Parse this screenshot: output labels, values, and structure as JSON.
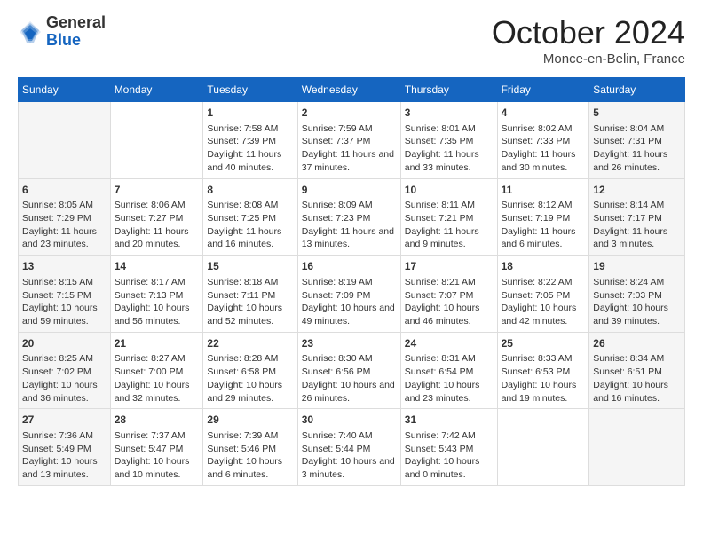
{
  "header": {
    "logo": {
      "general": "General",
      "blue": "Blue"
    },
    "title": "October 2024",
    "location": "Monce-en-Belin, France"
  },
  "days_of_week": [
    "Sunday",
    "Monday",
    "Tuesday",
    "Wednesday",
    "Thursday",
    "Friday",
    "Saturday"
  ],
  "weeks": [
    [
      {
        "day": "",
        "sunrise": "",
        "sunset": "",
        "daylight": ""
      },
      {
        "day": "",
        "sunrise": "",
        "sunset": "",
        "daylight": ""
      },
      {
        "day": "1",
        "sunrise": "Sunrise: 7:58 AM",
        "sunset": "Sunset: 7:39 PM",
        "daylight": "Daylight: 11 hours and 40 minutes."
      },
      {
        "day": "2",
        "sunrise": "Sunrise: 7:59 AM",
        "sunset": "Sunset: 7:37 PM",
        "daylight": "Daylight: 11 hours and 37 minutes."
      },
      {
        "day": "3",
        "sunrise": "Sunrise: 8:01 AM",
        "sunset": "Sunset: 7:35 PM",
        "daylight": "Daylight: 11 hours and 33 minutes."
      },
      {
        "day": "4",
        "sunrise": "Sunrise: 8:02 AM",
        "sunset": "Sunset: 7:33 PM",
        "daylight": "Daylight: 11 hours and 30 minutes."
      },
      {
        "day": "5",
        "sunrise": "Sunrise: 8:04 AM",
        "sunset": "Sunset: 7:31 PM",
        "daylight": "Daylight: 11 hours and 26 minutes."
      }
    ],
    [
      {
        "day": "6",
        "sunrise": "Sunrise: 8:05 AM",
        "sunset": "Sunset: 7:29 PM",
        "daylight": "Daylight: 11 hours and 23 minutes."
      },
      {
        "day": "7",
        "sunrise": "Sunrise: 8:06 AM",
        "sunset": "Sunset: 7:27 PM",
        "daylight": "Daylight: 11 hours and 20 minutes."
      },
      {
        "day": "8",
        "sunrise": "Sunrise: 8:08 AM",
        "sunset": "Sunset: 7:25 PM",
        "daylight": "Daylight: 11 hours and 16 minutes."
      },
      {
        "day": "9",
        "sunrise": "Sunrise: 8:09 AM",
        "sunset": "Sunset: 7:23 PM",
        "daylight": "Daylight: 11 hours and 13 minutes."
      },
      {
        "day": "10",
        "sunrise": "Sunrise: 8:11 AM",
        "sunset": "Sunset: 7:21 PM",
        "daylight": "Daylight: 11 hours and 9 minutes."
      },
      {
        "day": "11",
        "sunrise": "Sunrise: 8:12 AM",
        "sunset": "Sunset: 7:19 PM",
        "daylight": "Daylight: 11 hours and 6 minutes."
      },
      {
        "day": "12",
        "sunrise": "Sunrise: 8:14 AM",
        "sunset": "Sunset: 7:17 PM",
        "daylight": "Daylight: 11 hours and 3 minutes."
      }
    ],
    [
      {
        "day": "13",
        "sunrise": "Sunrise: 8:15 AM",
        "sunset": "Sunset: 7:15 PM",
        "daylight": "Daylight: 10 hours and 59 minutes."
      },
      {
        "day": "14",
        "sunrise": "Sunrise: 8:17 AM",
        "sunset": "Sunset: 7:13 PM",
        "daylight": "Daylight: 10 hours and 56 minutes."
      },
      {
        "day": "15",
        "sunrise": "Sunrise: 8:18 AM",
        "sunset": "Sunset: 7:11 PM",
        "daylight": "Daylight: 10 hours and 52 minutes."
      },
      {
        "day": "16",
        "sunrise": "Sunrise: 8:19 AM",
        "sunset": "Sunset: 7:09 PM",
        "daylight": "Daylight: 10 hours and 49 minutes."
      },
      {
        "day": "17",
        "sunrise": "Sunrise: 8:21 AM",
        "sunset": "Sunset: 7:07 PM",
        "daylight": "Daylight: 10 hours and 46 minutes."
      },
      {
        "day": "18",
        "sunrise": "Sunrise: 8:22 AM",
        "sunset": "Sunset: 7:05 PM",
        "daylight": "Daylight: 10 hours and 42 minutes."
      },
      {
        "day": "19",
        "sunrise": "Sunrise: 8:24 AM",
        "sunset": "Sunset: 7:03 PM",
        "daylight": "Daylight: 10 hours and 39 minutes."
      }
    ],
    [
      {
        "day": "20",
        "sunrise": "Sunrise: 8:25 AM",
        "sunset": "Sunset: 7:02 PM",
        "daylight": "Daylight: 10 hours and 36 minutes."
      },
      {
        "day": "21",
        "sunrise": "Sunrise: 8:27 AM",
        "sunset": "Sunset: 7:00 PM",
        "daylight": "Daylight: 10 hours and 32 minutes."
      },
      {
        "day": "22",
        "sunrise": "Sunrise: 8:28 AM",
        "sunset": "Sunset: 6:58 PM",
        "daylight": "Daylight: 10 hours and 29 minutes."
      },
      {
        "day": "23",
        "sunrise": "Sunrise: 8:30 AM",
        "sunset": "Sunset: 6:56 PM",
        "daylight": "Daylight: 10 hours and 26 minutes."
      },
      {
        "day": "24",
        "sunrise": "Sunrise: 8:31 AM",
        "sunset": "Sunset: 6:54 PM",
        "daylight": "Daylight: 10 hours and 23 minutes."
      },
      {
        "day": "25",
        "sunrise": "Sunrise: 8:33 AM",
        "sunset": "Sunset: 6:53 PM",
        "daylight": "Daylight: 10 hours and 19 minutes."
      },
      {
        "day": "26",
        "sunrise": "Sunrise: 8:34 AM",
        "sunset": "Sunset: 6:51 PM",
        "daylight": "Daylight: 10 hours and 16 minutes."
      }
    ],
    [
      {
        "day": "27",
        "sunrise": "Sunrise: 7:36 AM",
        "sunset": "Sunset: 5:49 PM",
        "daylight": "Daylight: 10 hours and 13 minutes."
      },
      {
        "day": "28",
        "sunrise": "Sunrise: 7:37 AM",
        "sunset": "Sunset: 5:47 PM",
        "daylight": "Daylight: 10 hours and 10 minutes."
      },
      {
        "day": "29",
        "sunrise": "Sunrise: 7:39 AM",
        "sunset": "Sunset: 5:46 PM",
        "daylight": "Daylight: 10 hours and 6 minutes."
      },
      {
        "day": "30",
        "sunrise": "Sunrise: 7:40 AM",
        "sunset": "Sunset: 5:44 PM",
        "daylight": "Daylight: 10 hours and 3 minutes."
      },
      {
        "day": "31",
        "sunrise": "Sunrise: 7:42 AM",
        "sunset": "Sunset: 5:43 PM",
        "daylight": "Daylight: 10 hours and 0 minutes."
      },
      {
        "day": "",
        "sunrise": "",
        "sunset": "",
        "daylight": ""
      },
      {
        "day": "",
        "sunrise": "",
        "sunset": "",
        "daylight": ""
      }
    ]
  ]
}
